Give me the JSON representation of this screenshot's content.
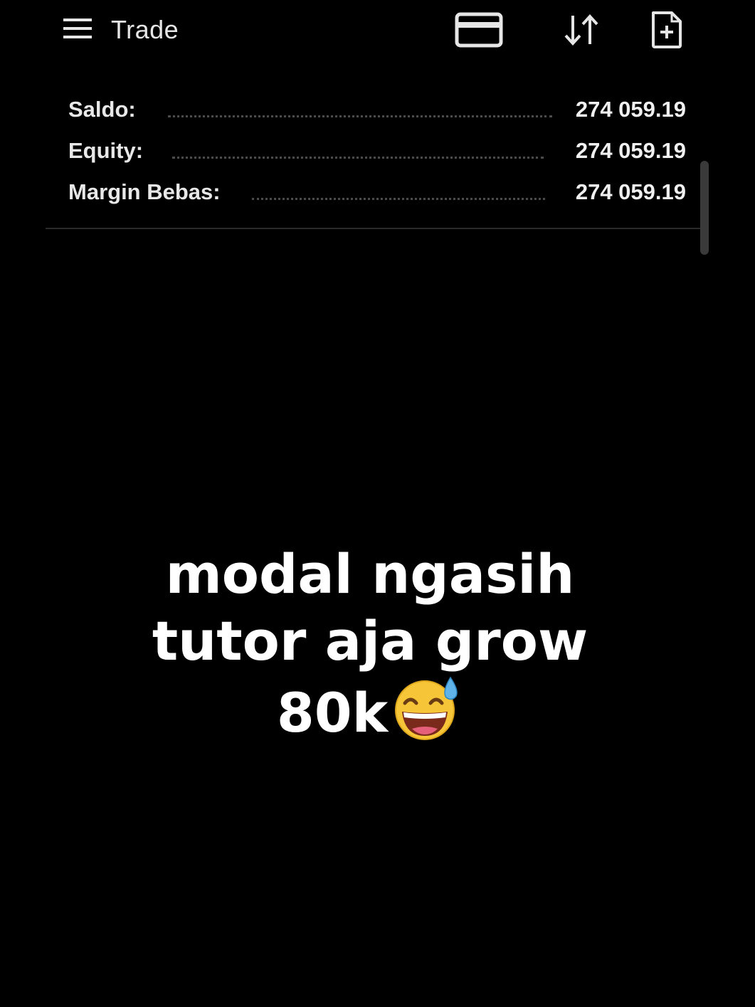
{
  "header": {
    "title": "Trade",
    "icons": {
      "menu": "menu-icon",
      "card": "credit-card-icon",
      "sort": "sort-icon",
      "new_order": "new-document-icon"
    }
  },
  "account_summary": [
    {
      "label": "Saldo:",
      "value": "274 059.19"
    },
    {
      "label": "Equity:",
      "value": "274 059.19"
    },
    {
      "label": "Margin Bebas:",
      "value": "274 059.19"
    }
  ],
  "caption": {
    "line1": "modal ngasih",
    "line2": "tutor aja grow",
    "line3": "80k",
    "emoji": "grinning-face-with-sweat"
  },
  "colors": {
    "background": "#000000",
    "text": "#ffffff",
    "divider": "#2a2a2a",
    "dots": "#4b4b4b",
    "emoji_face": "#f7c538"
  }
}
